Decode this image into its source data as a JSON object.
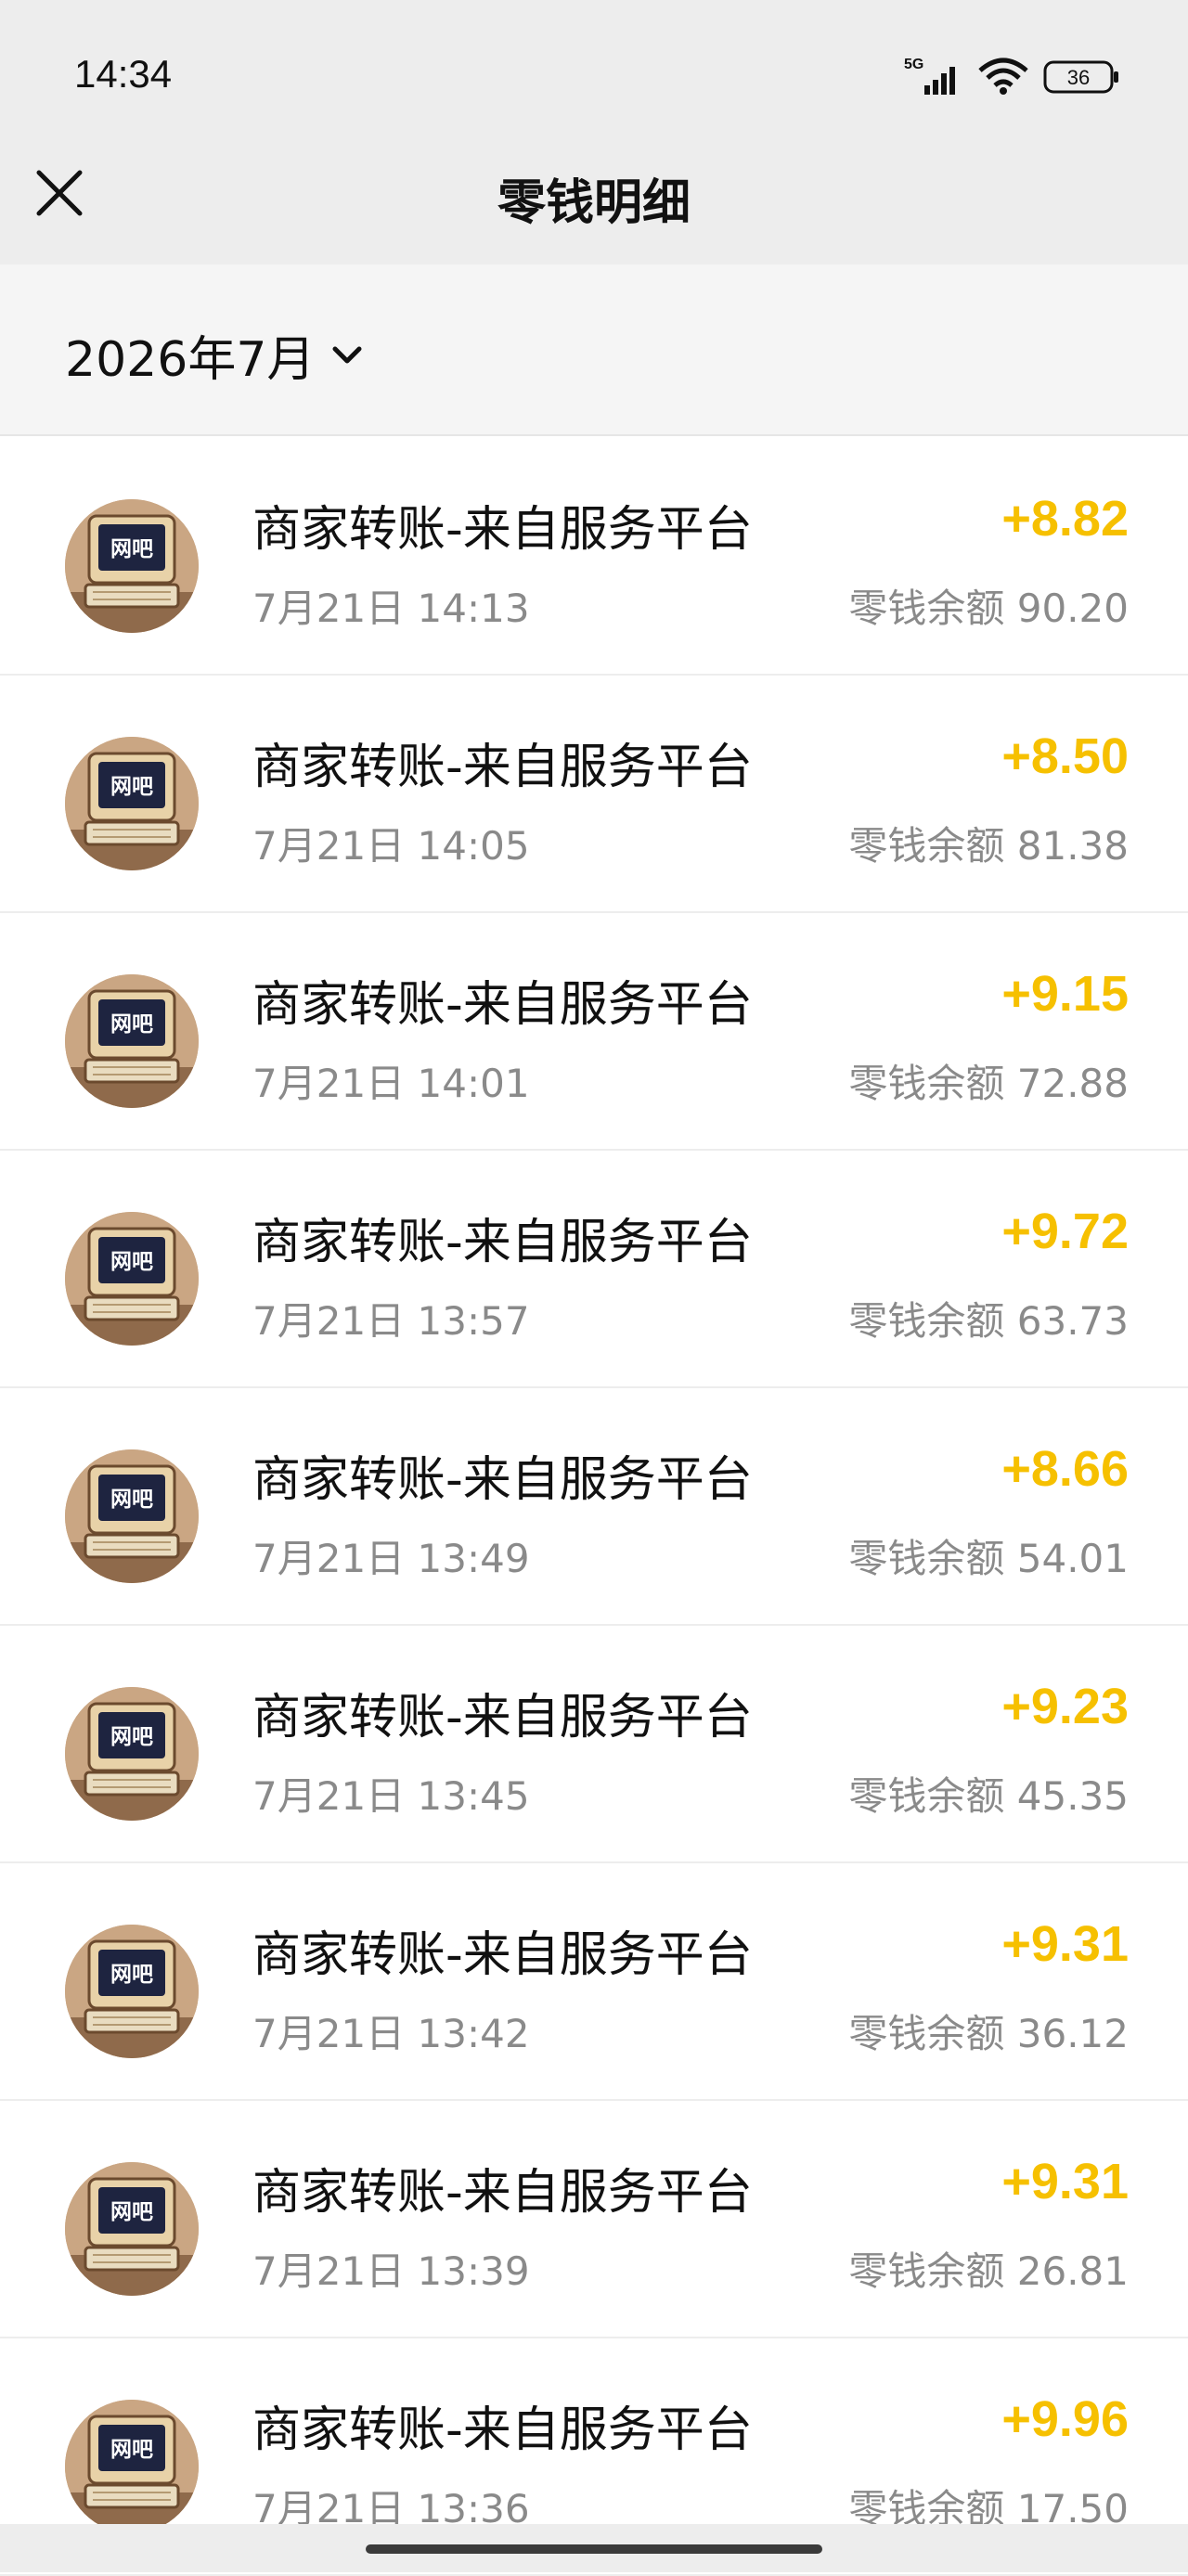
{
  "status_bar": {
    "time": "14:34",
    "network": "5G",
    "battery": "36"
  },
  "header": {
    "title": "零钱明细"
  },
  "filter": {
    "month": "2026年7月"
  },
  "colors": {
    "amount": "#f6c000",
    "header_bg": "#ededed"
  },
  "transactions": [
    {
      "title": "商家转账-来自服务平台",
      "time": "7月21日 14:13",
      "amount": "+8.82",
      "balance": "零钱余额 90.20"
    },
    {
      "title": "商家转账-来自服务平台",
      "time": "7月21日 14:05",
      "amount": "+8.50",
      "balance": "零钱余额 81.38"
    },
    {
      "title": "商家转账-来自服务平台",
      "time": "7月21日 14:01",
      "amount": "+9.15",
      "balance": "零钱余额 72.88"
    },
    {
      "title": "商家转账-来自服务平台",
      "time": "7月21日 13:57",
      "amount": "+9.72",
      "balance": "零钱余额 63.73"
    },
    {
      "title": "商家转账-来自服务平台",
      "time": "7月21日 13:49",
      "amount": "+8.66",
      "balance": "零钱余额 54.01"
    },
    {
      "title": "商家转账-来自服务平台",
      "time": "7月21日 13:45",
      "amount": "+9.23",
      "balance": "零钱余额 45.35"
    },
    {
      "title": "商家转账-来自服务平台",
      "time": "7月21日 13:42",
      "amount": "+9.31",
      "balance": "零钱余额 36.12"
    },
    {
      "title": "商家转账-来自服务平台",
      "time": "7月21日 13:39",
      "amount": "+9.31",
      "balance": "零钱余额 26.81"
    },
    {
      "title": "商家转账-来自服务平台",
      "time": "7月21日 13:36",
      "amount": "+9.96",
      "balance": "零钱余额 17.50"
    }
  ],
  "avatar_text": "网吧"
}
